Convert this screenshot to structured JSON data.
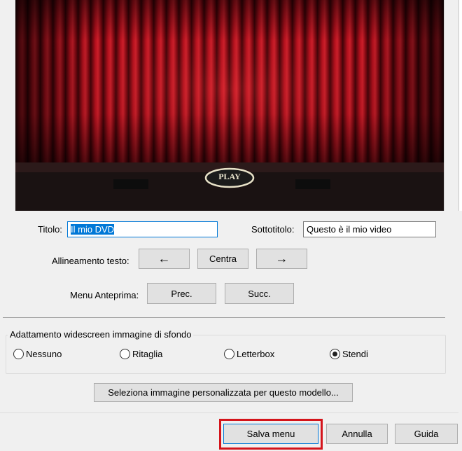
{
  "preview": {
    "play_label": "PLAY"
  },
  "title_row": {
    "title_label": "Titolo:",
    "title_value": "Il mio DVD",
    "subtitle_label": "Sottotitolo:",
    "subtitle_value": "Questo è il mio video"
  },
  "alignment": {
    "label": "Allineamento testo:",
    "left_glyph": "←",
    "center_label": "Centra",
    "right_glyph": "→"
  },
  "menu_preview": {
    "label": "Menu Anteprima:",
    "prev_label": "Prec.",
    "next_label": "Succ."
  },
  "widescreen": {
    "group_title": "Adattamento widescreen immagine di sfondo",
    "options": [
      {
        "label": "Nessuno",
        "selected": false
      },
      {
        "label": "Ritaglia",
        "selected": false
      },
      {
        "label": "Letterbox",
        "selected": false
      },
      {
        "label": "Stendi",
        "selected": true
      }
    ]
  },
  "custom_image_button": "Seleziona immagine personalizzata per questo modello...",
  "footer": {
    "save_label": "Salva menu",
    "cancel_label": "Annulla",
    "help_label": "Guida"
  },
  "colors": {
    "highlight": "#d4141b",
    "curtain": "#b3121c",
    "focus": "#0078d7"
  }
}
